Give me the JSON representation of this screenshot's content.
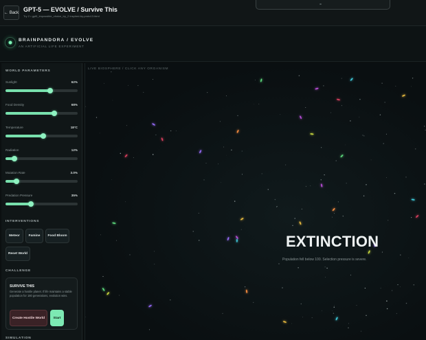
{
  "topbar": {
    "back_label": "Back",
    "title": "GPT-5 — EVOLVE / Survive This",
    "subtitle": "Try 2 • gpt5_impossible_choice_try_2 inspired-by-proto13.html"
  },
  "brand": {
    "name": "BRAINPANDORA / EVOLVE",
    "tagline": "AN ARTIFICIAL LIFE EXPERIMENT"
  },
  "sidebar": {
    "world_parameters_title": "WORLD PARAMETERS",
    "params": [
      {
        "label": "Sunlight",
        "value": "62%",
        "fraction": 0.62
      },
      {
        "label": "Food Density",
        "value": "68%",
        "fraction": 0.68
      },
      {
        "label": "Temperature",
        "value": "18°C",
        "fraction": 0.52
      },
      {
        "label": "Radiation",
        "value": "12%",
        "fraction": 0.12
      },
      {
        "label": "Mutation Rate",
        "value": "3.0%",
        "fraction": 0.15
      },
      {
        "label": "Predation Pressure",
        "value": "35%",
        "fraction": 0.35
      }
    ],
    "interventions_title": "INTERVENTIONS",
    "interventions": {
      "meteor": "Meteor",
      "famine": "Famine",
      "food_bloom": "Food Bloom",
      "reset_world": "Reset World"
    },
    "challenge_title": "CHALLENGE",
    "challenge": {
      "heading": "SURVIVE THIS",
      "description": "Generate a hostile planet. If life maintains a stable population for 180 generations, evolution wins.",
      "create_label": "Create Hostile World",
      "start_label": "Start"
    },
    "simulation_title": "SIMULATION"
  },
  "biosphere": {
    "label": "LIVE BIOSPHERE / CLICK ANY ORGANISM",
    "status_title": "EXTINCTION",
    "status_subtitle": "Population fell below 100. Selection pressure is severe.",
    "organism_colors": [
      "#f0c040",
      "#d0e040",
      "#9b6dff",
      "#e04060",
      "#40d0e0",
      "#ff9040",
      "#60e080",
      "#c050e0"
    ]
  }
}
